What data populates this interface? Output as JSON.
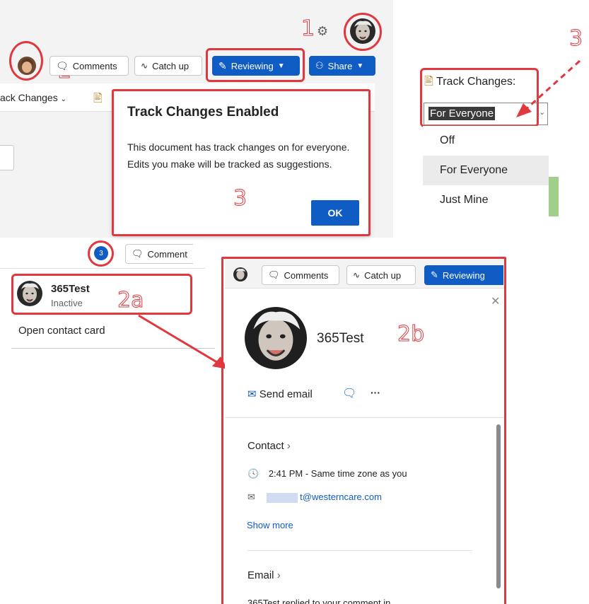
{
  "toolbar": {
    "comments_label": "Comments",
    "catchup_label": "Catch up",
    "reviewing_label": "Reviewing",
    "share_label": "Share",
    "track_changes_left_label": "ack Changes"
  },
  "annotations": {
    "n1": "1",
    "n2": "2",
    "n3a": "3",
    "n3b": "3",
    "n2a": "2a",
    "n2b": "2b"
  },
  "dialog": {
    "title": "Track Changes Enabled",
    "body": "This document has track changes on for everyone. Edits you make will be tracked as suggestions.",
    "ok_label": "OK"
  },
  "track_changes_menu": {
    "label": "Track Changes:",
    "selected": "For Everyone",
    "options": [
      "Off",
      "For Everyone",
      "Just Mine"
    ]
  },
  "presence": {
    "badge_count": "3",
    "comments_label": "Comment",
    "user_name": "365Test",
    "user_status": "Inactive",
    "open_contact_card": "Open contact card"
  },
  "contact_card": {
    "toolbar": {
      "comments_label": "Comments",
      "catchup_label": "Catch up",
      "reviewing_label": "Reviewing"
    },
    "name": "365Test",
    "send_email_label": "Send email",
    "more_label": "···",
    "contact_section": "Contact",
    "time_text": "2:41 PM - Same time zone as you",
    "email_text": "t@westerncare.com",
    "show_more": "Show more",
    "email_section": "Email",
    "truncated_text": "365Test replied to your comment in"
  },
  "colors": {
    "accent_blue": "#0f5cc4",
    "annotation_red": "#e0383e"
  }
}
